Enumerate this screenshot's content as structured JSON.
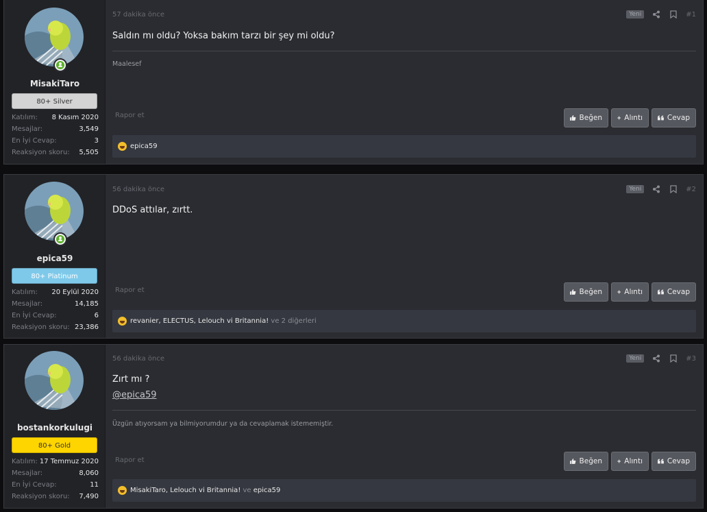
{
  "posts": [
    {
      "user": {
        "name": "MisakiTaro",
        "rank": "80+ Silver",
        "rank_bg": "#d4d4d4",
        "rank_fg": "#333333",
        "online": true
      },
      "stats": [
        {
          "key": "Katılım:",
          "value": "8 Kasım 2020"
        },
        {
          "key": "Mesajlar:",
          "value": "3,549"
        },
        {
          "key": "En İyi Cevap:",
          "value": "3"
        },
        {
          "key": "Reaksiyon skoru:",
          "value": "5,505"
        }
      ],
      "time": "57 dakika önce",
      "badge": "Yeni",
      "number": "#1",
      "body": [
        "Saldın mı oldu? Yoksa bakım tarzı bir şey mi oldu?"
      ],
      "signature": "Maalesef",
      "report": "Rapor et",
      "buttons": {
        "like": "Beğen",
        "quote": "Alıntı",
        "reply": "Cevap"
      },
      "reactions": {
        "names": "epica59",
        "extra_sep": "",
        "extra": ""
      }
    },
    {
      "user": {
        "name": "epica59",
        "rank": "80+ Platinum",
        "rank_bg": "#7ec9ea",
        "rank_fg": "#1f3a4a",
        "online": true
      },
      "stats": [
        {
          "key": "Katılım:",
          "value": "20 Eylül 2020"
        },
        {
          "key": "Mesajlar:",
          "value": "14,185"
        },
        {
          "key": "En İyi Cevap:",
          "value": "6"
        },
        {
          "key": "Reaksiyon skoru:",
          "value": "23,386"
        }
      ],
      "time": "56 dakika önce",
      "badge": "Yeni",
      "number": "#2",
      "body": [
        "DDoS attılar, zırtt."
      ],
      "signature": "",
      "report": "Rapor et",
      "buttons": {
        "like": "Beğen",
        "quote": "Alıntı",
        "reply": "Cevap"
      },
      "reactions": {
        "names": "revanier, ELECTUS, Lelouch vi Britannia!",
        "extra_sep": " ve ",
        "extra": "2 diğerleri"
      }
    },
    {
      "user": {
        "name": "bostankorkulugi",
        "rank": "80+ Gold",
        "rank_bg": "#ffd500",
        "rank_fg": "#3a3200",
        "online": false
      },
      "stats": [
        {
          "key": "Katılım:",
          "value": "17 Temmuz 2020"
        },
        {
          "key": "Mesajlar:",
          "value": "8,060"
        },
        {
          "key": "En İyi Cevap:",
          "value": "11"
        },
        {
          "key": "Reaksiyon skoru:",
          "value": "7,490"
        }
      ],
      "time": "56 dakika önce",
      "badge": "Yeni",
      "number": "#3",
      "body": [
        "Zırt mı ?"
      ],
      "mention": "@epica59",
      "signature": "Üzgün atıyorsam ya bilmiyorumdur ya da cevaplamak istememiştir.",
      "report": "Rapor et",
      "buttons": {
        "like": "Beğen",
        "quote": "Alıntı",
        "reply": "Cevap"
      },
      "reactions": {
        "names": "MisakiTaro, Lelouch vi Britannia!",
        "extra_sep": " ve ",
        "extra": "epica59"
      }
    }
  ]
}
